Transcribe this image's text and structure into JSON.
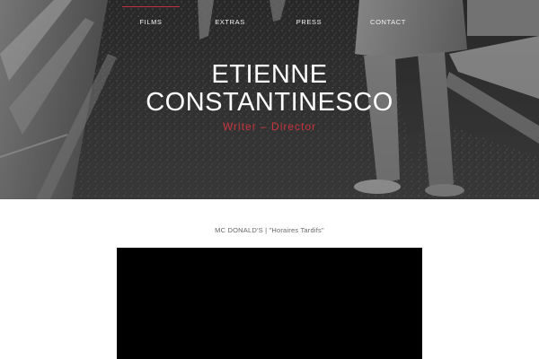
{
  "nav": {
    "items": [
      {
        "label": "FILMS",
        "active": true
      },
      {
        "label": "EXTRAS",
        "active": false
      },
      {
        "label": "PRESS",
        "active": false
      },
      {
        "label": "CONTACT",
        "active": false
      }
    ]
  },
  "hero": {
    "title_line1": "ETIENNE",
    "title_line2": "CONSTANTINESCO",
    "subtitle": "Writer – Director"
  },
  "content": {
    "caption": "MC DONALD'S | \"Horaires Tardifs\""
  },
  "colors": {
    "accent": "#c8343c",
    "video_bg": "#000000"
  }
}
